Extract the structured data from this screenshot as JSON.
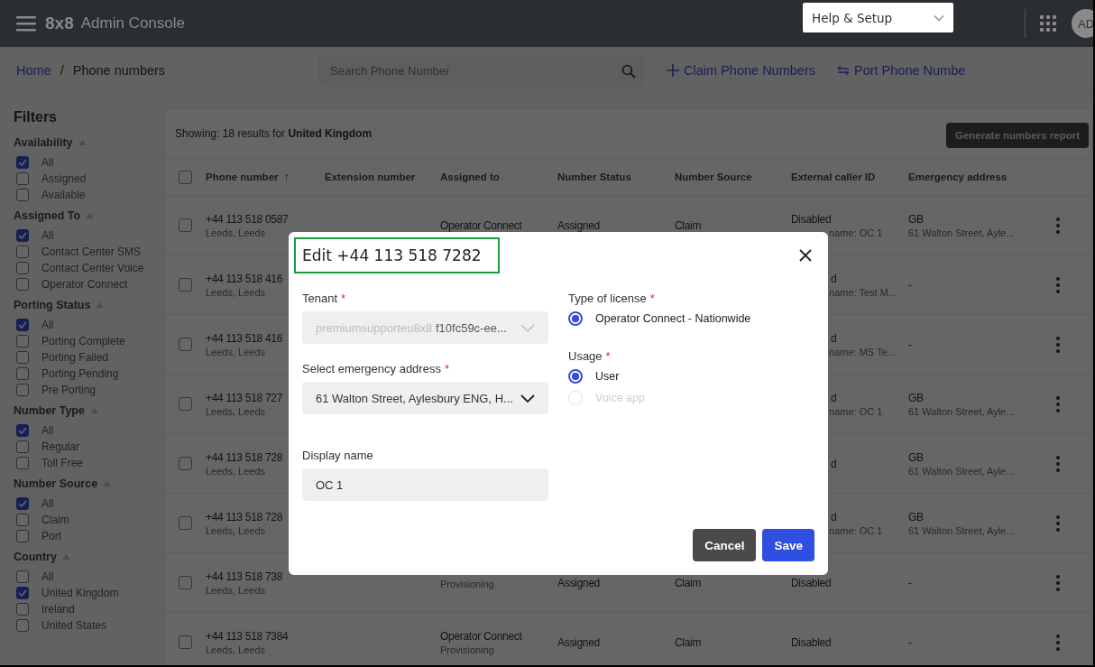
{
  "header": {
    "brand": "8x8",
    "title": "Admin Console",
    "help_menu": "Help & Setup",
    "avatar": "AD"
  },
  "breadcrumb": {
    "home": "Home",
    "separator": "/",
    "current": "Phone numbers"
  },
  "search": {
    "placeholder": "Search Phone Number"
  },
  "actions": [
    {
      "kind": "add",
      "label": "Claim Phone Numbers"
    },
    {
      "kind": "port",
      "label": "Port Phone Numbe"
    }
  ],
  "filters": {
    "title": "Filters",
    "groups": [
      {
        "title": "Availability",
        "expanded": true,
        "items": [
          {
            "label": "All",
            "checked": true
          },
          {
            "label": "Assigned",
            "checked": false
          },
          {
            "label": "Available",
            "checked": false
          }
        ]
      },
      {
        "title": "Assigned To",
        "expanded": true,
        "items": [
          {
            "label": "All",
            "checked": true
          },
          {
            "label": "Contact Center SMS",
            "checked": false
          },
          {
            "label": "Contact Center Voice",
            "checked": false
          },
          {
            "label": "Operator Connect",
            "checked": false
          }
        ]
      },
      {
        "title": "Porting Status",
        "expanded": true,
        "items": [
          {
            "label": "All",
            "checked": true
          },
          {
            "label": "Porting Complete",
            "checked": false
          },
          {
            "label": "Porting Failed",
            "checked": false
          },
          {
            "label": "Porting Pending",
            "checked": false
          },
          {
            "label": "Pre Porting",
            "checked": false
          }
        ]
      },
      {
        "title": "Number Type",
        "expanded": true,
        "items": [
          {
            "label": "All",
            "checked": true
          },
          {
            "label": "Regular",
            "checked": false
          },
          {
            "label": "Toll Free",
            "checked": false
          }
        ]
      },
      {
        "title": "Number Source",
        "expanded": true,
        "items": [
          {
            "label": "All",
            "checked": true
          },
          {
            "label": "Claim",
            "checked": false
          },
          {
            "label": "Port",
            "checked": false
          }
        ]
      },
      {
        "title": "Country",
        "expanded": true,
        "items": [
          {
            "label": "All",
            "checked": false
          },
          {
            "label": "United Kingdom",
            "checked": true
          },
          {
            "label": "Ireland",
            "checked": false
          },
          {
            "label": "United States",
            "checked": false
          }
        ]
      }
    ]
  },
  "results": {
    "summary": "Showing: 18 results for **United Kingdom**",
    "report_button": "Generate numbers report"
  },
  "table": {
    "select_all_checked": false,
    "columns": [
      {
        "label": "Phone number",
        "sort_arrow": "↑"
      },
      {
        "label": "Extension number"
      },
      {
        "label": "Assigned to"
      },
      {
        "label": "Number Status"
      },
      {
        "label": "Number Source"
      },
      {
        "label": "External caller ID"
      },
      {
        "label": "Emergency address"
      }
    ],
    "rows": [
      {
        "kind": "clear",
        "checked": false,
        "phone": "+44 113 518 0587",
        "location": "Leeds, Leeds",
        "assigned": "Operator Connect",
        "status": "Assigned",
        "source": "Claim",
        "caller": "Disabled",
        "caller_sub": "name: OC 1",
        "address": "GB",
        "address_sub": "61 Walton Street, Ayle..."
      },
      {
        "kind": "behind-dialog",
        "checked": false,
        "phone": "+44 113 518 416",
        "location": "Leeds, Leeds",
        "caller": "d",
        "caller_sub": "name: Test M...",
        "address": "-"
      },
      {
        "kind": "behind-dialog",
        "checked": false,
        "phone": "+44 113 518 416",
        "location": "Leeds, Leeds",
        "caller": "d",
        "caller_sub": "name: MS Te...",
        "address": "-"
      },
      {
        "kind": "behind-dialog",
        "checked": false,
        "phone": "+44 113 518 727",
        "location": "Leeds, Leeds",
        "caller": "d",
        "caller_sub": "name: OC 1",
        "address": "GB",
        "address_sub": "61 Walton Street, Ayle..."
      },
      {
        "kind": "behind-dialog",
        "checked": false,
        "phone": "+44 113 518 728",
        "location": "Leeds, Leeds",
        "caller": "d",
        "address": "GB",
        "address_sub": "61 Walton Street, Ayle..."
      },
      {
        "kind": "behind-dialog",
        "checked": false,
        "phone": "+44 113 518 728",
        "location": "Leeds, Leeds",
        "caller": "d",
        "caller_sub": "name: OC 1",
        "address": "GB",
        "address_sub": "61 Walton Street, Ayle..."
      },
      {
        "kind": "clear",
        "checked": false,
        "phone": "+44 113 518 738",
        "location": "Leeds, Leeds",
        "assigned_sub": "Provisioning",
        "status": "Assigned",
        "source": "Claim",
        "caller": "Disabled",
        "address": "-"
      },
      {
        "kind": "clear",
        "checked": false,
        "phone": "+44 113 518 7384",
        "location": "Leeds, Leeds",
        "assigned": "Operator Connect",
        "assigned_sub": "Provisioning",
        "status": "Assigned",
        "source": "Claim",
        "caller": "Disabled",
        "address": "-"
      }
    ]
  },
  "dialog": {
    "title": "Edit +44 113 518 7282",
    "tenant": {
      "label": "Tenant",
      "required_mark": "*",
      "name": "premiumsupporteu8x8",
      "id": "f10fc59c-ee...",
      "disabled": true
    },
    "emergency_address": {
      "label": "Select emergency address",
      "required_mark": "*",
      "value": "61 Walton Street, Aylesbury ENG, H..."
    },
    "display_name": {
      "label": "Display name",
      "value": "OC 1"
    },
    "license": {
      "label": "Type of license",
      "required_mark": "*",
      "options": [
        {
          "label": "Operator Connect - Nationwide",
          "selected": true,
          "disabled": false
        }
      ]
    },
    "usage": {
      "label": "Usage",
      "required_mark": "*",
      "options": [
        {
          "label": "User",
          "selected": true,
          "disabled": false
        },
        {
          "label": "Voice app",
          "selected": false,
          "disabled": true
        }
      ]
    },
    "buttons": [
      {
        "kind": "secondary",
        "label": "Cancel"
      },
      {
        "kind": "primary",
        "label": "Save"
      }
    ]
  }
}
